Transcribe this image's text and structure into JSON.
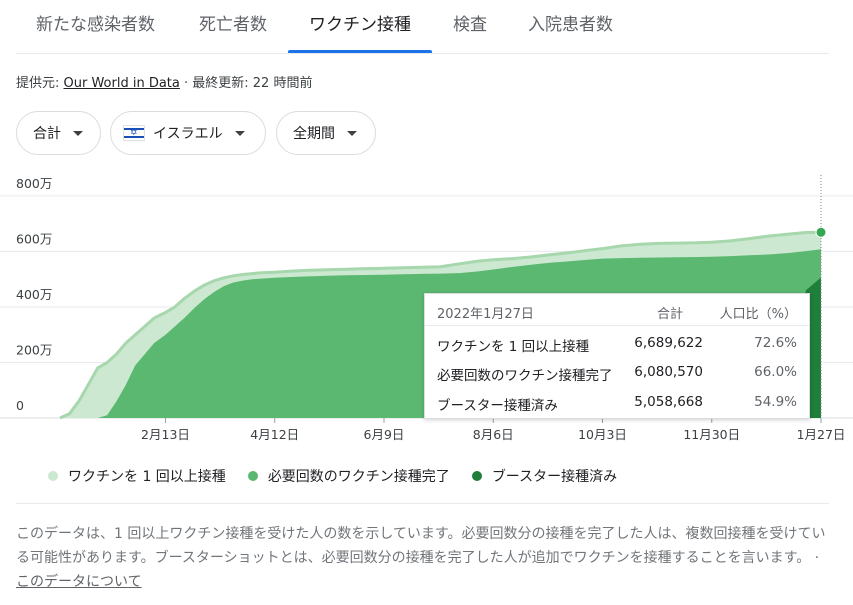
{
  "tabs": [
    {
      "label": "新たな感染者数"
    },
    {
      "label": "死亡者数"
    },
    {
      "label": "ワクチン接種"
    },
    {
      "label": "検査"
    },
    {
      "label": "入院患者数"
    }
  ],
  "active_tab": 2,
  "source": {
    "prefix": "提供元: ",
    "link": "Our World in Data",
    "updated": " · 最終更新: 22 時間前"
  },
  "filters": {
    "metric": "合計",
    "country": "イスラエル",
    "period": "全期間"
  },
  "tooltip": {
    "date": "2022年1月27日",
    "col_total": "合計",
    "col_pct": "人口比（%）",
    "rows": [
      {
        "label": "ワクチンを 1 回以上接種",
        "total": "6,689,622",
        "pct": "72.6%"
      },
      {
        "label": "必要回数のワクチン接種完了",
        "total": "6,080,570",
        "pct": "66.0%"
      },
      {
        "label": "ブースター接種済み",
        "total": "5,058,668",
        "pct": "54.9%"
      }
    ]
  },
  "colors": {
    "first_dose": "#cce8d0",
    "first_dose_line": "#a6d7ad",
    "fully": "#5bb871",
    "booster": "#1e7e3a",
    "tab_active": "#1a73e8"
  },
  "chart_data": {
    "type": "area",
    "x_tick_labels": [
      "2月13日",
      "4月12日",
      "6月9日",
      "8月6日",
      "10月3日",
      "11月30日",
      "1月27日"
    ],
    "y_tick_labels": [
      "0",
      "200万",
      "400万",
      "600万",
      "800万"
    ],
    "ylim": [
      0,
      8500000
    ],
    "x": [
      "2020-12-19",
      "2020-12-24",
      "2020-12-29",
      "2021-01-03",
      "2021-01-08",
      "2021-01-13",
      "2021-01-18",
      "2021-01-23",
      "2021-01-28",
      "2021-02-02",
      "2021-02-07",
      "2021-02-13",
      "2021-02-18",
      "2021-02-23",
      "2021-03-01",
      "2021-03-06",
      "2021-03-11",
      "2021-03-16",
      "2021-03-21",
      "2021-03-26",
      "2021-03-31",
      "2021-04-05",
      "2021-04-12",
      "2021-04-21",
      "2021-04-30",
      "2021-05-10",
      "2021-05-20",
      "2021-05-30",
      "2021-06-09",
      "2021-06-19",
      "2021-06-29",
      "2021-07-09",
      "2021-07-19",
      "2021-07-29",
      "2021-08-06",
      "2021-08-16",
      "2021-08-26",
      "2021-09-05",
      "2021-09-15",
      "2021-09-25",
      "2021-10-03",
      "2021-10-13",
      "2021-10-23",
      "2021-11-02",
      "2021-11-12",
      "2021-11-22",
      "2021-11-30",
      "2021-12-10",
      "2021-12-20",
      "2021-12-30",
      "2022-01-09",
      "2022-01-19",
      "2022-01-27"
    ],
    "series": [
      {
        "name": "ワクチンを 1 回以上接種",
        "values": [
          0,
          150000,
          600000,
          1200000,
          1800000,
          2000000,
          2300000,
          2700000,
          3000000,
          3300000,
          3600000,
          3800000,
          4000000,
          4300000,
          4600000,
          4800000,
          4950000,
          5050000,
          5120000,
          5170000,
          5200000,
          5230000,
          5250000,
          5290000,
          5320000,
          5340000,
          5360000,
          5380000,
          5390000,
          5410000,
          5430000,
          5450000,
          5550000,
          5650000,
          5700000,
          5740000,
          5800000,
          5880000,
          5950000,
          6040000,
          6100000,
          6200000,
          6260000,
          6290000,
          6300000,
          6310000,
          6330000,
          6380000,
          6460000,
          6550000,
          6620000,
          6680000,
          6689622
        ]
      },
      {
        "name": "必要回数のワクチン接種完了",
        "values": [
          0,
          0,
          0,
          0,
          0,
          100000,
          600000,
          1200000,
          1900000,
          2300000,
          2700000,
          3000000,
          3300000,
          3600000,
          4000000,
          4300000,
          4550000,
          4750000,
          4880000,
          4950000,
          5000000,
          5020000,
          5050000,
          5080000,
          5100000,
          5120000,
          5140000,
          5150000,
          5160000,
          5180000,
          5190000,
          5200000,
          5220000,
          5280000,
          5350000,
          5440000,
          5520000,
          5590000,
          5640000,
          5700000,
          5740000,
          5760000,
          5770000,
          5780000,
          5790000,
          5800000,
          5810000,
          5830000,
          5860000,
          5890000,
          5940000,
          6010000,
          6080570
        ]
      },
      {
        "name": "ブースター接種済み",
        "values": [
          0,
          0,
          0,
          0,
          0,
          0,
          0,
          0,
          0,
          0,
          0,
          0,
          0,
          0,
          0,
          0,
          0,
          0,
          0,
          0,
          0,
          0,
          0,
          0,
          0,
          0,
          0,
          0,
          0,
          0,
          0,
          0,
          0,
          0,
          0,
          0,
          0,
          0,
          0,
          0,
          0,
          0,
          0,
          0,
          0,
          0,
          0,
          0,
          0,
          0,
          0,
          4600000,
          5058668
        ]
      }
    ]
  },
  "legend": [
    {
      "label": "ワクチンを 1 回以上接種",
      "color": "#cce8d0"
    },
    {
      "label": "必要回数のワクチン接種完了",
      "color": "#5bb871"
    },
    {
      "label": "ブースター接種済み",
      "color": "#1e7e3a"
    }
  ],
  "note": {
    "text": "このデータは、1 回以上ワクチン接種を受けた人の数を示しています。必要回数分の接種を完了した人は、複数回接種を受けている可能性があります。ブースターショットとは、必要回数分の接種を完了した人が追加でワクチンを接種することを言います。 · ",
    "link": "このデータについて"
  }
}
